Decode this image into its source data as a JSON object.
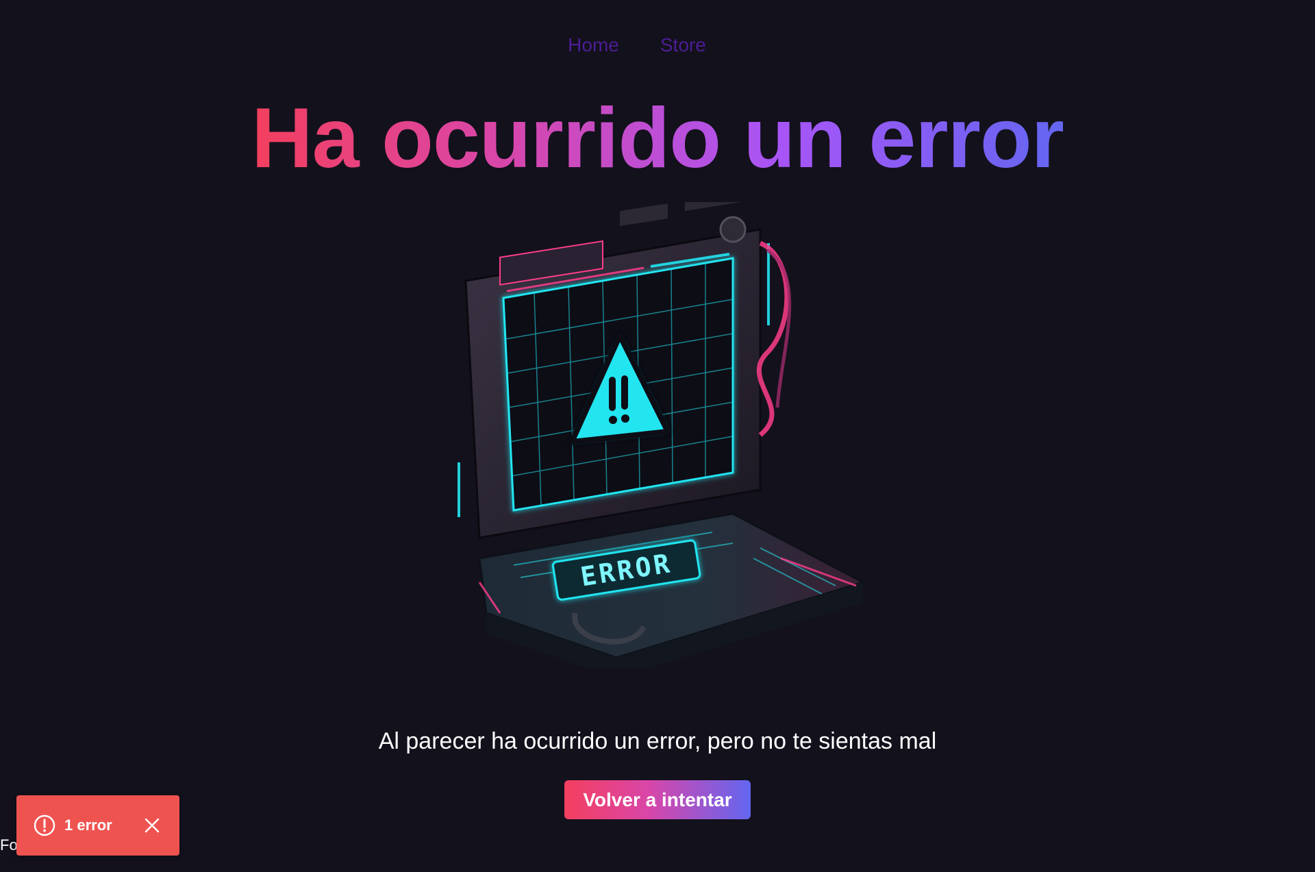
{
  "nav": {
    "home_label": "Home",
    "store_label": "Store"
  },
  "hero": {
    "title": "Ha ocurrido un error",
    "illustration_text": "ERROR",
    "subtitle": "Al parecer ha ocurrido un error, pero no te sientas mal",
    "retry_label": "Volver a intentar"
  },
  "footer": {
    "text": "Fo"
  },
  "error_toast": {
    "label": "1 error",
    "icon": "alert-circle-icon",
    "close_icon": "close-icon"
  },
  "colors": {
    "background": "#13111c",
    "nav_link": "#4c1d95",
    "gradient_start": "#f43f5e",
    "gradient_mid": "#a855f7",
    "gradient_end": "#6366f1",
    "toast_bg": "#ef5350",
    "neon_cyan": "#22e5f0",
    "neon_pink": "#ff3d8b"
  }
}
